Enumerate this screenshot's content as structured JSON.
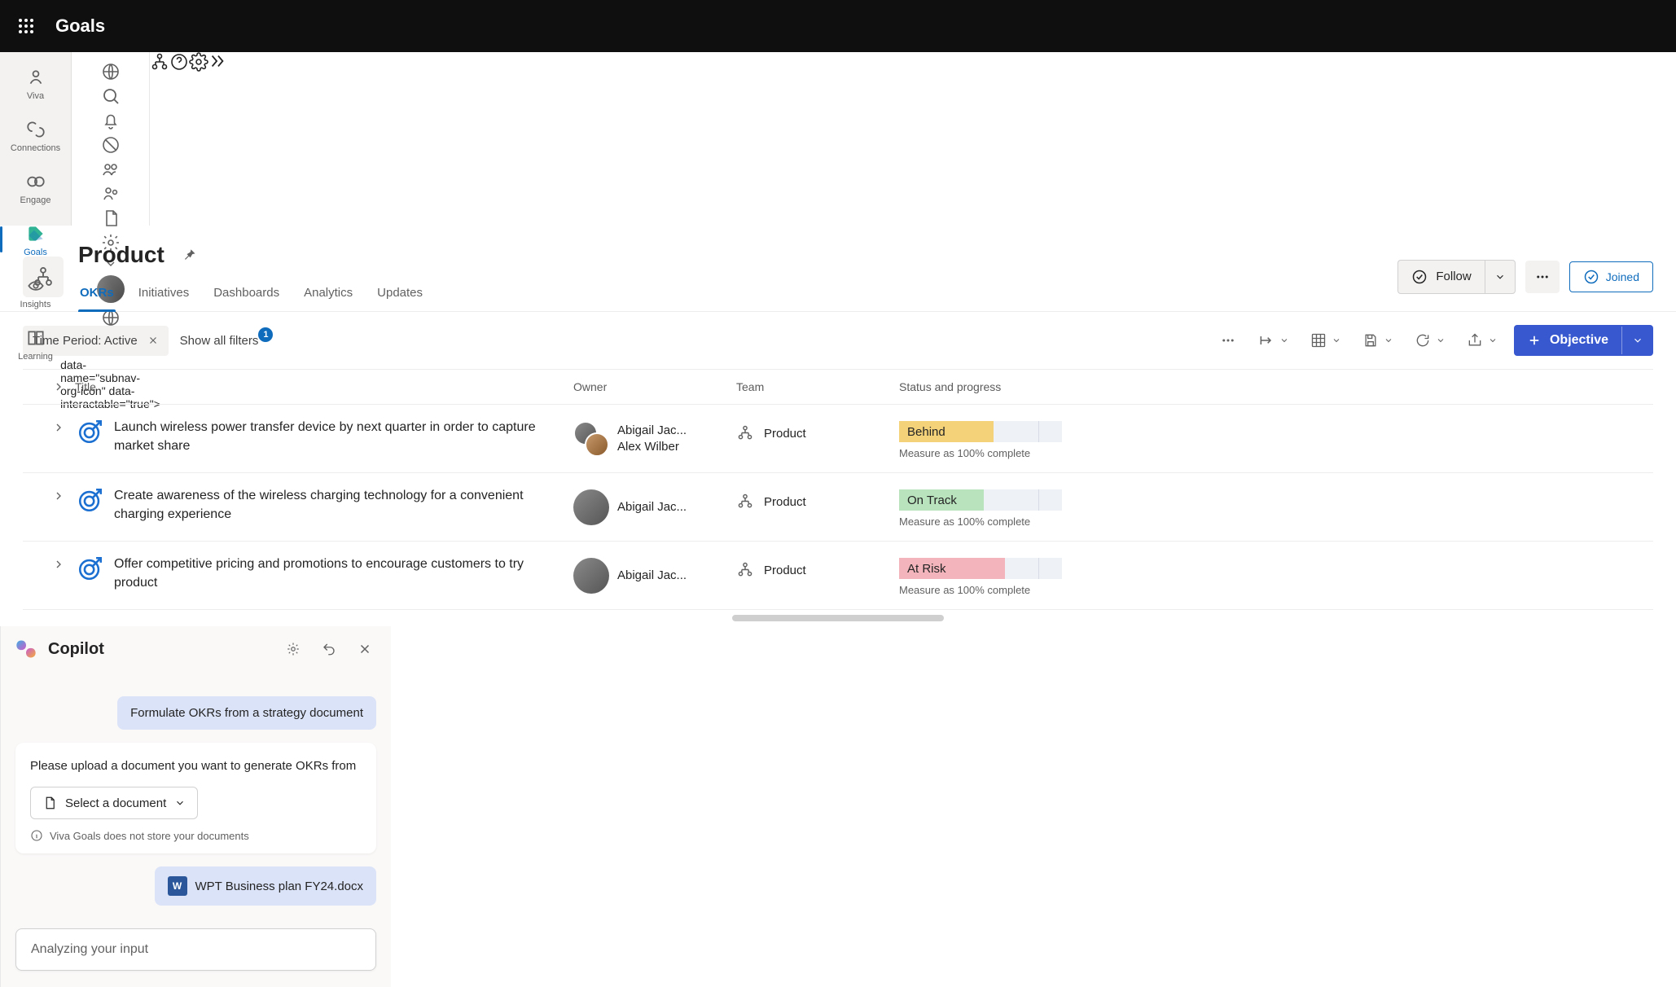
{
  "app": {
    "name": "Goals"
  },
  "rail": [
    {
      "id": "viva",
      "label": "Viva"
    },
    {
      "id": "connections",
      "label": "Connections"
    },
    {
      "id": "engage",
      "label": "Engage"
    },
    {
      "id": "goals",
      "label": "Goals"
    },
    {
      "id": "insights",
      "label": "Insights"
    },
    {
      "id": "learning",
      "label": "Learning"
    }
  ],
  "page": {
    "title": "Product",
    "tabs": [
      "OKRs",
      "Initiatives",
      "Dashboards",
      "Analytics",
      "Updates"
    ],
    "follow_label": "Follow",
    "joined_label": "Joined"
  },
  "filters": {
    "chip": "Time Period: Active",
    "show_all_label": "Show all filters",
    "badge_count": "1"
  },
  "toolbar": {
    "objective_label": "Objective"
  },
  "columns": {
    "title": "Title",
    "owner": "Owner",
    "team": "Team",
    "status": "Status and progress"
  },
  "rows": [
    {
      "title": "Launch wireless power transfer device by next quarter in order to capture market share",
      "owners": [
        "Abigail Jac...",
        "Alex Wilber"
      ],
      "team": "Product",
      "status": "Behind",
      "status_key": "behind",
      "measure": "Measure as 100% complete"
    },
    {
      "title": "Create awareness of the wireless charging technology for a convenient charging experience",
      "owners": [
        "Abigail Jac..."
      ],
      "team": "Product",
      "status": "On Track",
      "status_key": "ontrack",
      "measure": "Measure as 100% complete"
    },
    {
      "title": "Offer competitive pricing and promotions to encourage customers to try product",
      "owners": [
        "Abigail Jac..."
      ],
      "team": "Product",
      "status": "At Risk",
      "status_key": "atrisk",
      "measure": "Measure as 100% complete"
    }
  ],
  "copilot": {
    "title": "Copilot",
    "user_msg": "Formulate OKRs from a strategy document",
    "assistant_msg": "Please upload a document you want to generate OKRs from",
    "select_doc_label": "Select a document",
    "privacy_note": "Viva Goals does not store your documents",
    "file_name": "WPT Business plan FY24.docx",
    "word_badge": "W",
    "input_placeholder": "Analyzing your input"
  }
}
